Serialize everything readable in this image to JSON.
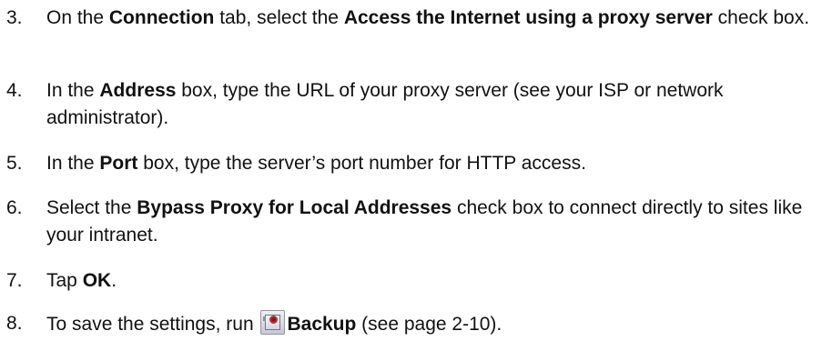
{
  "steps": [
    {
      "number": "3.",
      "parts": [
        {
          "text": "On the ",
          "bold": false
        },
        {
          "text": "Connection",
          "bold": true
        },
        {
          "text": " tab, select the ",
          "bold": false
        },
        {
          "text": "Access the Internet using a proxy server",
          "bold": true
        },
        {
          "text": " check box.",
          "bold": false
        }
      ]
    },
    {
      "number": "4.",
      "parts": [
        {
          "text": "In the ",
          "bold": false
        },
        {
          "text": "Address",
          "bold": true
        },
        {
          "text": " box, type the URL of your proxy server (see your ISP or network administrator).",
          "bold": false
        }
      ]
    },
    {
      "number": "5.",
      "parts": [
        {
          "text": "In the ",
          "bold": false
        },
        {
          "text": "Port",
          "bold": true
        },
        {
          "text": " box, type the server’s port number for HTTP access.",
          "bold": false
        }
      ]
    },
    {
      "number": "6.",
      "parts": [
        {
          "text": "Select the ",
          "bold": false
        },
        {
          "text": "Bypass Proxy for Local Addresses",
          "bold": true
        },
        {
          "text": " check box to connect directly to sites like your intranet.",
          "bold": false
        }
      ]
    },
    {
      "number": "7.",
      "parts": [
        {
          "text": "Tap ",
          "bold": false
        },
        {
          "text": "OK",
          "bold": true
        },
        {
          "text": ".",
          "bold": false
        }
      ]
    },
    {
      "number": "8.",
      "parts": [
        {
          "text": "To save the settings, run ",
          "bold": false
        },
        {
          "icon": "backup-icon"
        },
        {
          "text": "Backup",
          "bold": true
        },
        {
          "text": " (see page 2-10).",
          "bold": false
        }
      ]
    }
  ]
}
